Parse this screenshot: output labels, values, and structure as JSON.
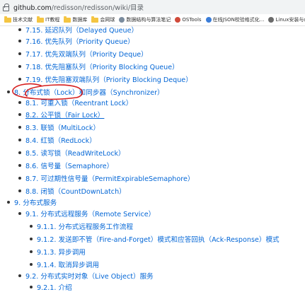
{
  "browser": {
    "url_host": "github.com",
    "url_path": "/redisson/redisson/wiki/目录",
    "bookmarks": [
      {
        "label": "技术文献",
        "icon": "folder-icon"
      },
      {
        "label": "IT教程",
        "icon": "folder-icon"
      },
      {
        "label": "数据库",
        "icon": "folder-icon"
      },
      {
        "label": "会网球",
        "icon": "folder-icon"
      },
      {
        "label": "数据结构与算法笔记",
        "icon": "site-icon",
        "color": "#7b8c9e"
      },
      {
        "label": "OSTools",
        "icon": "site-icon",
        "color": "#d04a3a"
      },
      {
        "label": "在线JSON校验格式化...",
        "icon": "site-icon",
        "color": "#3b7dd8"
      },
      {
        "label": "Linux安装与命令大全",
        "icon": "site-icon",
        "color": "#6a6a6a"
      }
    ]
  },
  "toc": {
    "items": [
      {
        "text": "7.15. 延迟队列（Delayed Queue）",
        "kind": "link"
      },
      {
        "text": "7.16. 优先队列（Priority Queue）",
        "kind": "link"
      },
      {
        "text": "7.17. 优先双端队列（Priority Deque）",
        "kind": "link"
      },
      {
        "text": "7.18. 优先阻塞队列（Priority Blocking Queue）",
        "kind": "link"
      },
      {
        "text": "7.19. 优先阻塞双端队列（Priority Blocking Deque）",
        "kind": "link"
      },
      {
        "text": "8. 分布式锁（Lock）和同步器（Synchronizer）",
        "kind": "link"
      },
      {
        "text": "8.1. 可重入锁（Reentrant Lock）",
        "kind": "link"
      },
      {
        "text": "8.2. 公平锁（Fair Lock）",
        "kind": "link"
      },
      {
        "text": "8.3. 联锁（MultiLock）",
        "kind": "link"
      },
      {
        "text": "8.4. 红锁（RedLock）",
        "kind": "link"
      },
      {
        "text": "8.5. 读写锁（ReadWriteLock）",
        "kind": "link"
      },
      {
        "text": "8.6. 信号量（Semaphore）",
        "kind": "link"
      },
      {
        "text": "8.7. 可过期性信号量（PermitExpirableSemaphore）",
        "kind": "link"
      },
      {
        "text": "8.8. 闭锁（CountDownLatch）",
        "kind": "link"
      },
      {
        "text": "9. 分布式服务",
        "kind": "link"
      },
      {
        "text": "9.1. 分布式远程服务（Remote Service）",
        "kind": "link"
      },
      {
        "text": "9.1.1. 分布式远程服务工作流程",
        "kind": "link"
      },
      {
        "text": "9.1.2. 发送即不管（Fire-and-Forget）模式和应答回执（Ack-Response）模式",
        "kind": "link"
      },
      {
        "text": "9.1.3. 异步调用",
        "kind": "link"
      },
      {
        "text": "9.1.4. 取消异步调用",
        "kind": "link"
      },
      {
        "text": "9.2. 分布式实时对象（Live Object）服务",
        "kind": "link"
      },
      {
        "text": "9.2.1. 介绍",
        "kind": "link"
      }
    ]
  },
  "colors": {
    "link": "#0366d6",
    "annotation": "#d62020"
  }
}
